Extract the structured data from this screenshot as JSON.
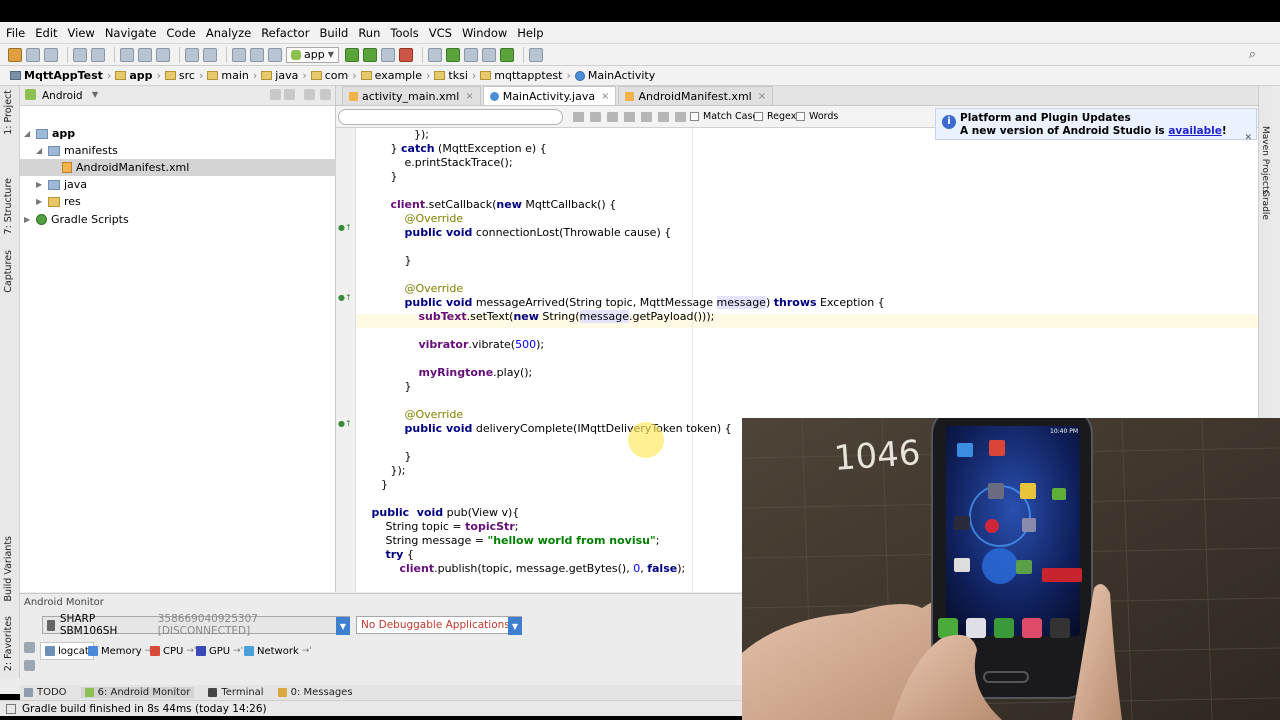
{
  "menubar": [
    "File",
    "Edit",
    "View",
    "Navigate",
    "Code",
    "Analyze",
    "Refactor",
    "Build",
    "Run",
    "Tools",
    "VCS",
    "Window",
    "Help"
  ],
  "toolbar": {
    "run_config": "app"
  },
  "breadcrumb": [
    "MqttAppTest",
    "app",
    "src",
    "main",
    "java",
    "com",
    "example",
    "tksi",
    "mqttapptest",
    "MainActivity"
  ],
  "left_stripe": [
    "1: Project",
    "7: Structure",
    "Captures",
    "Build Variants",
    "2: Favorites"
  ],
  "right_stripe": [
    "Maven Projects",
    "Gradle"
  ],
  "project": {
    "view": "Android",
    "tree": [
      "app",
      "manifests",
      "AndroidManifest.xml",
      "java",
      "res",
      "Gradle Scripts"
    ]
  },
  "tabs": [
    "activity_main.xml",
    "MainActivity.java",
    "AndroidManifest.xml"
  ],
  "findbar": {
    "match_case": "Match Case",
    "regex": "Regex",
    "words": "Words"
  },
  "notification": {
    "title": "Platform and Plugin Updates",
    "line_prefix": "A new version of Android Studio is ",
    "link": "available",
    "line_suffix": "!"
  },
  "code": [
    [
      [
        "p",
        "    });"
      ]
    ],
    [
      [
        "p",
        "} "
      ],
      [
        "kw",
        "catch"
      ],
      [
        "p",
        " (MqttException e) {"
      ]
    ],
    [
      [
        "p",
        "    e.printStackTrace();"
      ]
    ],
    [
      [
        "p",
        "}"
      ]
    ],
    [
      [
        "p",
        ""
      ]
    ],
    [
      [
        "fld",
        "client"
      ],
      [
        "p",
        ".setCallback("
      ],
      [
        "kw",
        "new"
      ],
      [
        "p",
        " MqttCallback() {"
      ]
    ],
    [
      [
        "p",
        "    "
      ],
      [
        "ann",
        "@Override"
      ]
    ],
    [
      [
        "p",
        "    "
      ],
      [
        "kw",
        "public void"
      ],
      [
        "p",
        " connectionLost(Throwable cause) {"
      ]
    ],
    [
      [
        "p",
        ""
      ]
    ],
    [
      [
        "p",
        "    }"
      ]
    ],
    [
      [
        "p",
        ""
      ]
    ],
    [
      [
        "p",
        "    "
      ],
      [
        "ann",
        "@Override"
      ]
    ],
    [
      [
        "p",
        "    "
      ],
      [
        "kw",
        "public void"
      ],
      [
        "p",
        " messageArrived(String topic, MqttMessage "
      ],
      [
        "hl",
        "message"
      ],
      [
        "p",
        ") "
      ],
      [
        "kw",
        "throws"
      ],
      [
        "p",
        " Exception {"
      ]
    ],
    [
      [
        "p",
        "        "
      ],
      [
        "fld",
        "subText"
      ],
      [
        "p",
        ".setText("
      ],
      [
        "kw",
        "new"
      ],
      [
        "p",
        " String("
      ],
      [
        "hl",
        "message"
      ],
      [
        "p",
        ".getPayload()));"
      ]
    ],
    [
      [
        "p",
        ""
      ]
    ],
    [
      [
        "p",
        "        "
      ],
      [
        "fld",
        "vibrator"
      ],
      [
        "p",
        ".vibrate("
      ],
      [
        "num",
        "500"
      ],
      [
        "p",
        ");"
      ]
    ],
    [
      [
        "p",
        ""
      ]
    ],
    [
      [
        "p",
        "        "
      ],
      [
        "fld",
        "myRingtone"
      ],
      [
        "p",
        ".play();"
      ]
    ],
    [
      [
        "p",
        "    }"
      ]
    ],
    [
      [
        "p",
        ""
      ]
    ],
    [
      [
        "p",
        "    "
      ],
      [
        "ann",
        "@Override"
      ]
    ],
    [
      [
        "p",
        "    "
      ],
      [
        "kw",
        "public void"
      ],
      [
        "p",
        " deliveryComplete(IMqttDeliveryToken token) {"
      ]
    ],
    [
      [
        "p",
        ""
      ]
    ],
    [
      [
        "p",
        "    }"
      ]
    ],
    [
      [
        "p",
        "});"
      ]
    ],
    [
      [
        "p",
        "}"
      ]
    ],
    [
      [
        "p",
        ""
      ]
    ],
    [
      [
        "kw",
        "public  void"
      ],
      [
        "p",
        " pub(View v){"
      ]
    ],
    [
      [
        "p",
        "    String topic = "
      ],
      [
        "fld",
        "topicStr"
      ],
      [
        "p",
        ";"
      ]
    ],
    [
      [
        "p",
        "    String message = "
      ],
      [
        "str",
        "\"hellow world from novisu\""
      ],
      [
        "p",
        ";"
      ]
    ],
    [
      [
        "p",
        "    "
      ],
      [
        "kw",
        "try"
      ],
      [
        "p",
        " {"
      ]
    ],
    [
      [
        "p",
        "        "
      ],
      [
        "fld",
        "client"
      ],
      [
        "p",
        ".publish(topic, message.getBytes(), "
      ],
      [
        "num",
        "0"
      ],
      [
        "p",
        ", "
      ],
      [
        "kw",
        "false"
      ],
      [
        "p",
        ");"
      ]
    ]
  ],
  "monitor": {
    "title": "Android Monitor",
    "device": "SHARP SBM106SH",
    "device_serial": "358669040925307 [DISCONNECTED]",
    "app": "No Debuggable Applications",
    "tabs": [
      "logcat",
      "Memory",
      "CPU",
      "GPU",
      "Network"
    ]
  },
  "tool_windows": [
    "TODO",
    "6: Android Monitor",
    "Terminal",
    "0: Messages"
  ],
  "status": "Gradle build finished in 8s 44ms (today 14:26)",
  "webcam": {
    "note_text": "1046",
    "phone_time": "10:40 PM"
  }
}
